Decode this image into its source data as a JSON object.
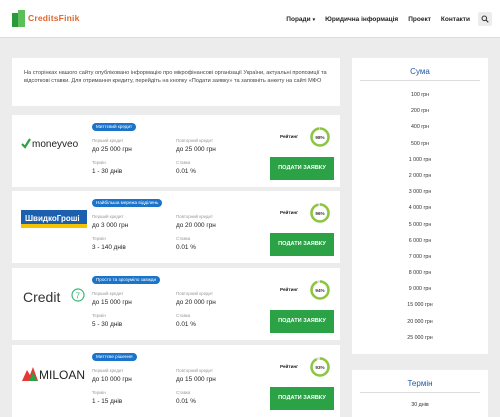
{
  "header": {
    "logo_text": "CreditsFinik",
    "nav": [
      {
        "label": "Поради",
        "has_dropdown": true
      },
      {
        "label": "Юридична інформація",
        "has_dropdown": false
      },
      {
        "label": "Проект",
        "has_dropdown": false
      },
      {
        "label": "Контакти",
        "has_dropdown": false
      }
    ],
    "search_icon": "search-icon"
  },
  "intro": {
    "text": "На сторінках нашого сайту опубліковано інформацію про мікрофінансові організації України, актуальні пропозиції та відсоткові ставки. Для отримання кредиту, перейдіть на кнопку «Подати заявку» та заповніть анкету на сайті МФО"
  },
  "labels": {
    "first_credit": "Перший кредит",
    "repeat_credit": "Повторний кредит",
    "term": "Термін",
    "rate": "Ставка",
    "rating": "Рейтинг"
  },
  "offers": [
    {
      "lender": "moneyveo",
      "badge": "Миттєвий кредит",
      "first_amount": "до 25 000 грн",
      "repeat_amount": "до 25 000 грн",
      "term": "1 - 30 днів",
      "rate": "0.01 %",
      "rating_text": "98%",
      "rating_value": 98,
      "apply_label": "ПОДАТИ ЗАЯВКУ"
    },
    {
      "lender": "ШвидкоГроші",
      "badge": "Найбільша мережа відділень",
      "first_amount": "до 3 000 грн",
      "repeat_amount": "до 20 000 грн",
      "term": "3 - 140 днів",
      "rate": "0.01 %",
      "rating_text": "96%",
      "rating_value": 96,
      "apply_label": "ПОДАТИ ЗАЯВКУ"
    },
    {
      "lender": "Credit7",
      "badge": "Просто та зрозуміло завжди",
      "first_amount": "до 15 000 грн",
      "repeat_amount": "до 20 000 грн",
      "term": "5 - 30 днів",
      "rate": "0.01 %",
      "rating_text": "94%",
      "rating_value": 94,
      "apply_label": "ПОДАТИ ЗАЯВКУ"
    },
    {
      "lender": "MILOAN",
      "badge": "Миттєве рішення",
      "first_amount": "до 10 000 грн",
      "repeat_amount": "до 15 000 грн",
      "term": "1 - 15 днів",
      "rate": "0.01 %",
      "rating_text": "93%",
      "rating_value": 93,
      "apply_label": "ПОДАТИ ЗАЯВКУ"
    }
  ],
  "sidebar": {
    "title": "Сума",
    "items": [
      "100 грн",
      "200 грн",
      "400 грн",
      "500 грн",
      "1 000 грн",
      "2 000 грн",
      "3 000 грн",
      "4 000 грн",
      "5 000 грн",
      "6 000 грн",
      "7 000 грн",
      "8 000 грн",
      "9 000 грн",
      "15 000 грн",
      "20 000 грн",
      "25 000 грн"
    ]
  },
  "sidebar2": {
    "title": "Термін",
    "items": [
      "30 днів"
    ]
  },
  "colors": {
    "accent_green": "#2aa245",
    "badge_blue": "#1b74c9",
    "title_blue": "#1f5aa6",
    "logo_orange": "#e0652a"
  }
}
